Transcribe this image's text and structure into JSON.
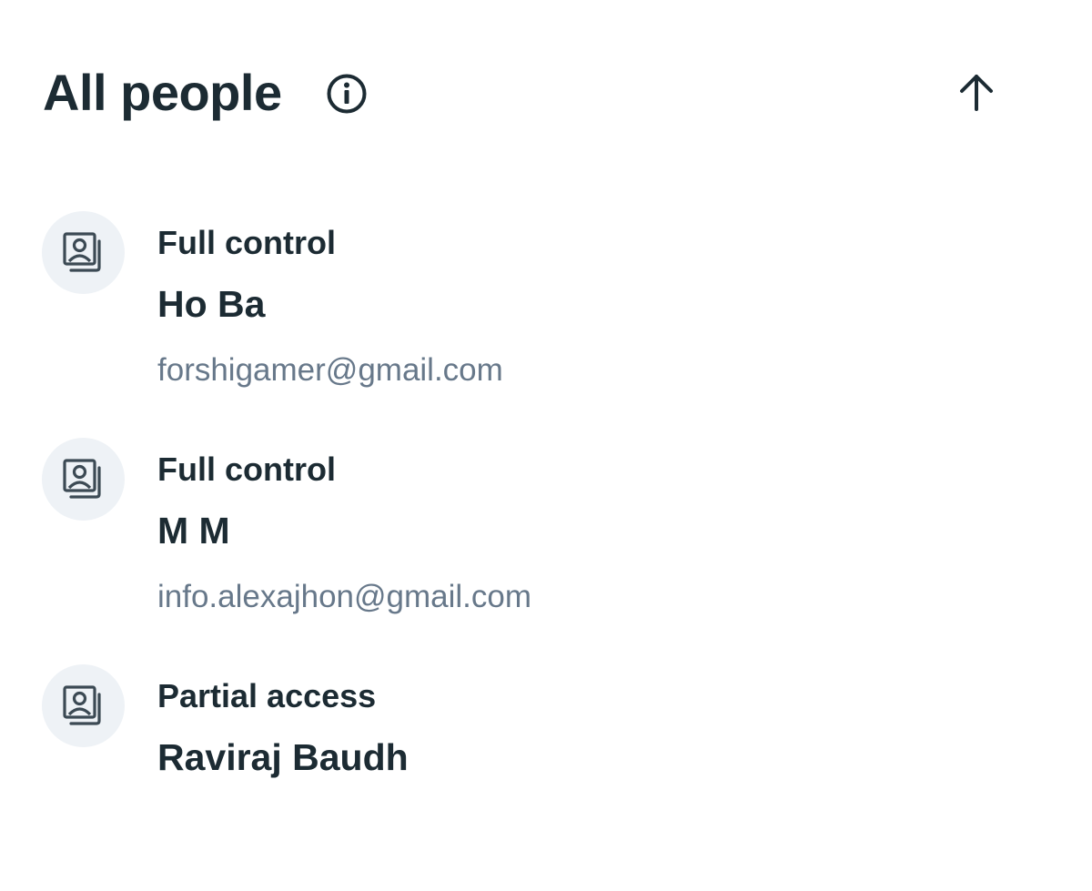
{
  "header": {
    "title": "All people",
    "info_icon": "info-circle-icon",
    "sort_icon": "arrow-up-icon"
  },
  "people": [
    {
      "role": "Full control",
      "name": "Ho Ba",
      "email": "forshigamer@gmail.com",
      "avatar_icon": "person-photo-icon"
    },
    {
      "role": "Full control",
      "name": "M M",
      "email": "info.alexajhon@gmail.com",
      "avatar_icon": "person-photo-icon"
    },
    {
      "role": "Partial access",
      "name": "Raviraj Baudh",
      "avatar_icon": "person-photo-icon"
    }
  ],
  "colors": {
    "text_primary": "#1c2b33",
    "text_secondary": "#67788a",
    "avatar_bg": "#eef2f6",
    "background": "#ffffff"
  }
}
